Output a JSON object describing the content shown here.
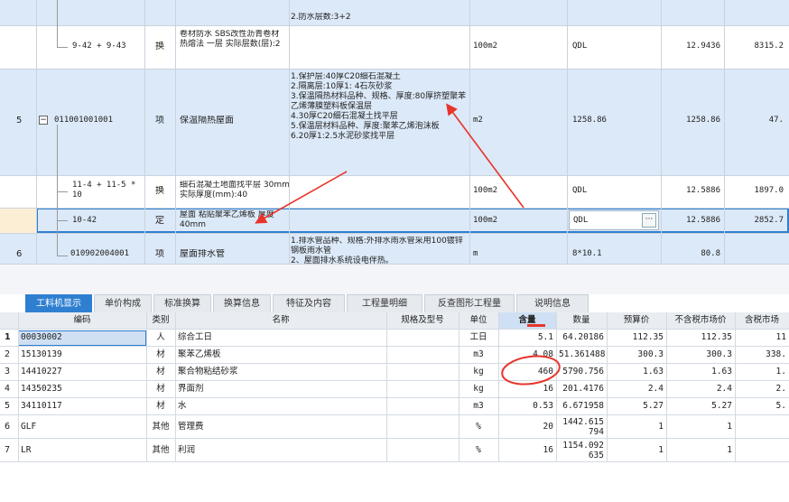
{
  "upper_rows": [
    {
      "desc": "2.防水层数:3+2"
    },
    {
      "code": "9-42 + 9-43",
      "type": "换",
      "name": "卷材防水 SBS改性沥青卷材 热熔法 一层 实际层数(层):2",
      "unit": "100m2",
      "qty_expr": "QDL",
      "qty": "12.9436",
      "price": "8315.2"
    },
    {
      "num": "5",
      "code": "011001001001",
      "type": "项",
      "name": "保温隔热屋面",
      "desc": "1.保护层:40厚C20细石混凝土\n2.隔离层:10厚1: 4石灰砂浆\n3.保温隔热材料品种、规格、厚度:80厚挤塑聚苯乙烯薄膜塑料板保温层\n4.30厚C20细石混凝土找平层\n5.保温层材料品种、厚度:聚苯乙烯泡沫板\n6.20厚1:2.5水泥砂浆找平层",
      "unit": "m2",
      "qty_expr": "1258.86",
      "qty": "1258.86",
      "price": "47."
    },
    {
      "code": "11-4 + 11-5 * 10",
      "type": "换",
      "name": "细石混凝土地面找平层 30mm 实际厚度(mm):40",
      "unit": "100m2",
      "qty_expr": "QDL",
      "qty": "12.5886",
      "price": "1897.0"
    },
    {
      "code": "10-42",
      "type": "定",
      "name": "屋面 粘贴聚苯乙烯板 厚度40mm",
      "unit": "100m2",
      "qty_expr": "QDL",
      "qty": "12.5886",
      "price": "2852.7"
    },
    {
      "num": "6",
      "code": "010902004001",
      "type": "项",
      "name": "屋面排水管",
      "desc": "1.排水管品种、规格:外排水雨水管采用100镀锌钢板雨水管\n2、屋面排水系统设电伴热。",
      "unit": "m",
      "qty_expr": "8*10.1",
      "qty": "80.8",
      "price": ""
    }
  ],
  "ellipsis": "···",
  "tabs": [
    "工料机显示",
    "单价构成",
    "标准换算",
    "换算信息",
    "特征及内容",
    "工程量明细",
    "反查图形工程量",
    "说明信息"
  ],
  "headers": [
    "编码",
    "类别",
    "名称",
    "规格及型号",
    "单位",
    "含量",
    "数量",
    "预算价",
    "不含税市场价",
    "含税市场"
  ],
  "rows": [
    {
      "n": "1",
      "code": "00030002",
      "cat": "人",
      "name": "综合工日",
      "unit": "工日",
      "content": "5.1",
      "qty": "64.20186",
      "budget": "112.35",
      "market": "112.35",
      "taxm": "11"
    },
    {
      "n": "2",
      "code": "15130139",
      "cat": "材",
      "name": "聚苯乙烯板",
      "unit": "m3",
      "content": "4.08",
      "qty": "51.361488",
      "budget": "300.3",
      "market": "300.3",
      "taxm": "338."
    },
    {
      "n": "3",
      "code": "14410227",
      "cat": "材",
      "name": "聚合物粘结砂浆",
      "unit": "kg",
      "content": "460",
      "qty": "5790.756",
      "budget": "1.63",
      "market": "1.63",
      "taxm": "1."
    },
    {
      "n": "4",
      "code": "14350235",
      "cat": "材",
      "name": "界面剂",
      "unit": "kg",
      "content": "16",
      "qty": "201.4176",
      "budget": "2.4",
      "market": "2.4",
      "taxm": "2."
    },
    {
      "n": "5",
      "code": "34110117",
      "cat": "材",
      "name": "水",
      "unit": "m3",
      "content": "0.53",
      "qty": "6.671958",
      "budget": "5.27",
      "market": "5.27",
      "taxm": "5."
    },
    {
      "n": "6",
      "code": "GLF",
      "cat": "其他",
      "name": "管理费",
      "unit": "%",
      "content": "20",
      "qty": "1442.615794",
      "budget": "1",
      "market": "1",
      "taxm": ""
    },
    {
      "n": "7",
      "code": "LR",
      "cat": "其他",
      "name": "利润",
      "unit": "%",
      "content": "16",
      "qty": "1154.092635",
      "budget": "1",
      "market": "1",
      "taxm": ""
    }
  ],
  "colors": {
    "accent": "#2f7fd1",
    "row_blue": "#dce9f8",
    "selected_yellow": "#fbeed5",
    "annotation_red": "#e8342b"
  }
}
